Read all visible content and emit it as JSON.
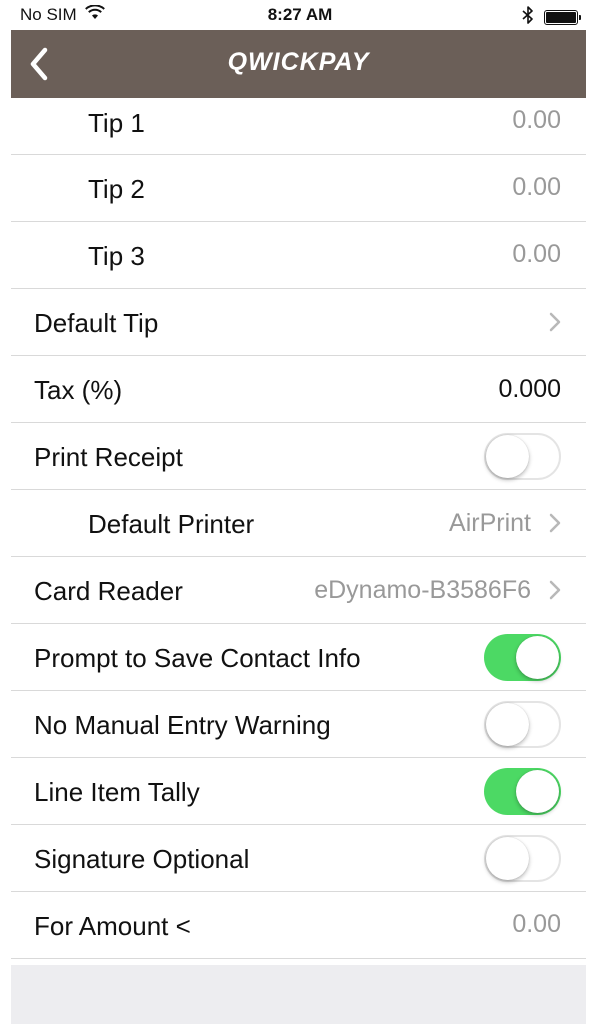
{
  "status_bar": {
    "carrier": "No SIM",
    "time": "8:27 AM",
    "wifi_icon": "wifi-icon",
    "bluetooth_icon": "bluetooth-icon",
    "battery_icon": "battery-icon"
  },
  "nav": {
    "back_icon": "chevron-left-icon",
    "title": "QWICKPAY",
    "bar_color": "#6b5f58"
  },
  "rows": {
    "tip1": {
      "label": "Tip 1",
      "value": "0.00"
    },
    "tip2": {
      "label": "Tip 2",
      "value": "0.00"
    },
    "tip3": {
      "label": "Tip 3",
      "value": "0.00"
    },
    "default_tip": {
      "label": "Default Tip"
    },
    "tax": {
      "label": "Tax (%)",
      "value": "0.000"
    },
    "print_receipt": {
      "label": "Print Receipt",
      "on": false
    },
    "default_printer": {
      "label": "Default Printer",
      "value": "AirPrint"
    },
    "card_reader": {
      "label": "Card Reader",
      "value": "eDynamo-B3586F6"
    },
    "prompt_save_contact": {
      "label": "Prompt to Save Contact Info",
      "on": true
    },
    "no_manual_entry": {
      "label": "No Manual Entry Warning",
      "on": false
    },
    "line_item_tally": {
      "label": "Line Item Tally",
      "on": true
    },
    "signature_optional": {
      "label": "Signature Optional",
      "on": false
    },
    "for_amount": {
      "label": "For Amount <",
      "value": "0.00"
    }
  },
  "colors": {
    "toggle_on": "#4cd964",
    "secondary_text": "#999999"
  }
}
